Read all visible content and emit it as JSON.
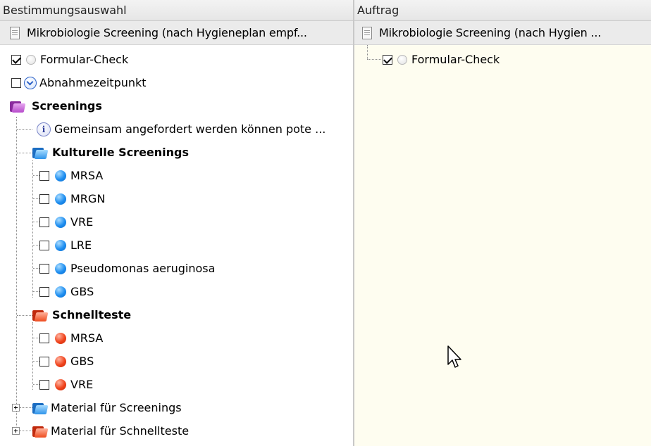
{
  "left_pane": {
    "header": "Bestimmungsauswahl",
    "root_label": "Mikrobiologie Screening (nach Hygieneplan empf...",
    "formular_check": {
      "label": "Formular-Check",
      "checked": true
    },
    "abnahme": {
      "label": "Abnahmezeitpunkt",
      "checked": false
    },
    "screenings": {
      "label": "Screenings",
      "info": "Gemeinsam angefordert werden können pote ...",
      "kulturelle": {
        "label": "Kulturelle Screenings",
        "items": [
          {
            "label": "MRSA",
            "checked": false
          },
          {
            "label": "MRGN",
            "checked": false
          },
          {
            "label": "VRE",
            "checked": false
          },
          {
            "label": "LRE",
            "checked": false
          },
          {
            "label": "Pseudomonas aeruginosa",
            "checked": false
          },
          {
            "label": "GBS",
            "checked": false
          }
        ]
      },
      "schnellteste": {
        "label": "Schnellteste",
        "items": [
          {
            "label": "MRSA",
            "checked": false
          },
          {
            "label": "GBS",
            "checked": false
          },
          {
            "label": "VRE",
            "checked": false
          }
        ]
      }
    },
    "material_screenings": "Material für Screenings",
    "material_schnellteste": "Material für Schnellteste"
  },
  "right_pane": {
    "header": "Auftrag",
    "root_label": "Mikrobiologie Screening (nach Hygien ...",
    "formular_check": {
      "label": "Formular-Check",
      "checked": true
    }
  },
  "icons": {
    "screenings_folder": "purple-folder-icon",
    "kulturelle_folder": "blue-folder-icon",
    "schnellteste_folder": "red-folder-icon",
    "material_screenings_folder": "blue-folder-icon",
    "material_schnellteste_folder": "red-folder-icon"
  }
}
